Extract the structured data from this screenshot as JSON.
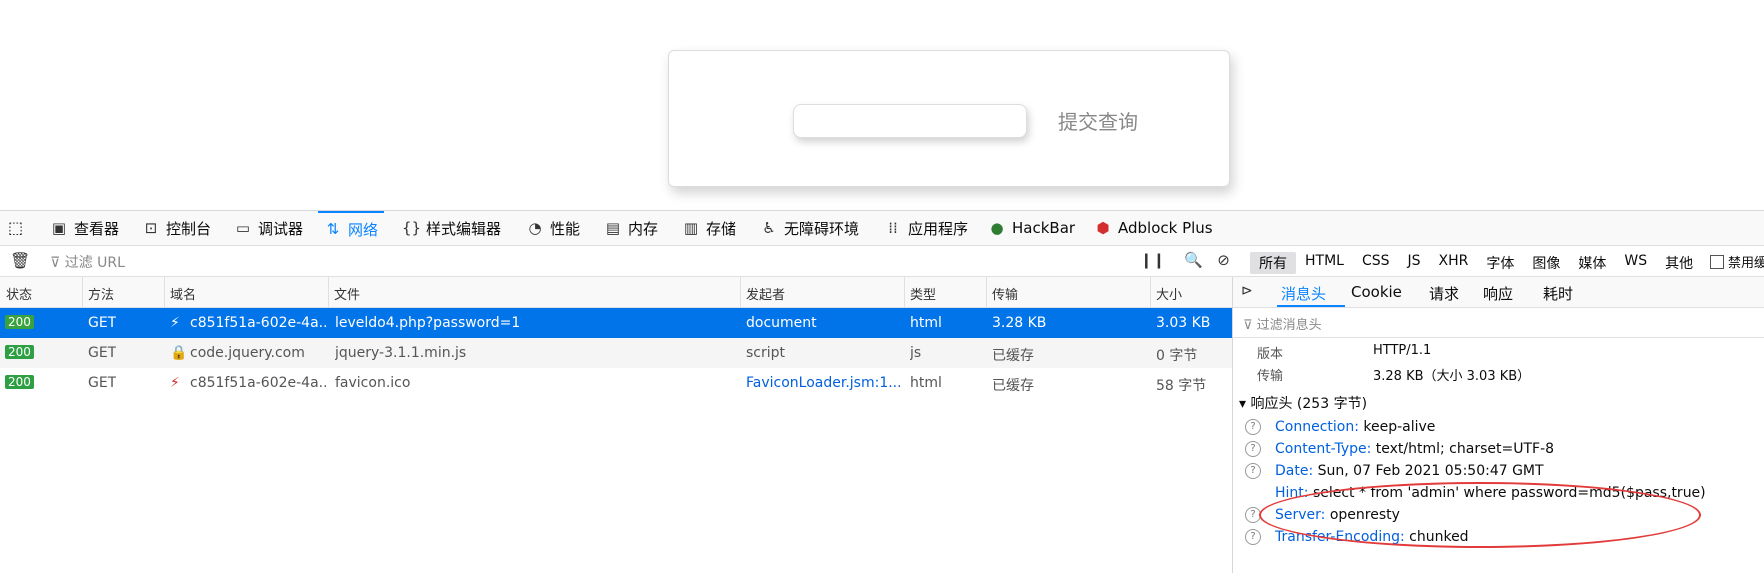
{
  "page": {
    "submit_label": "提交查询"
  },
  "devtools": {
    "tabs": [
      {
        "label": "查看器",
        "icon": "inspector-icon"
      },
      {
        "label": "控制台",
        "icon": "console-icon"
      },
      {
        "label": "调试器",
        "icon": "debugger-icon"
      },
      {
        "label": "网络",
        "icon": "network-icon",
        "active": true
      },
      {
        "label": "样式编辑器",
        "icon": "style-editor-icon"
      },
      {
        "label": "性能",
        "icon": "performance-icon"
      },
      {
        "label": "内存",
        "icon": "memory-icon"
      },
      {
        "label": "存储",
        "icon": "storage-icon"
      },
      {
        "label": "无障碍环境",
        "icon": "accessibility-icon"
      },
      {
        "label": "应用程序",
        "icon": "application-icon"
      },
      {
        "label": "HackBar",
        "icon": "hackbar-icon"
      },
      {
        "label": "Adblock Plus",
        "icon": "adblock-icon"
      }
    ],
    "filter_placeholder": "过滤 URL",
    "type_filters": [
      "所有",
      "HTML",
      "CSS",
      "JS",
      "XHR",
      "字体",
      "图像",
      "媒体",
      "WS",
      "其他"
    ],
    "disable_cache_label": "禁用缓",
    "columns": [
      "状态",
      "方法",
      "域名",
      "文件",
      "发起者",
      "类型",
      "传输",
      "大小"
    ],
    "requests": [
      {
        "status": "200",
        "method": "GET",
        "domain": "c851f51a-602e-4a...",
        "file": "leveldo4.php?password=1",
        "initiator": "document",
        "type": "html",
        "transferred": "3.28 KB",
        "size": "3.03 KB"
      },
      {
        "status": "200",
        "method": "GET",
        "domain": "code.jquery.com",
        "file": "jquery-3.1.1.min.js",
        "initiator": "script",
        "type": "js",
        "transferred": "已缓存",
        "size": "0 字节"
      },
      {
        "status": "200",
        "method": "GET",
        "domain": "c851f51a-602e-4a...",
        "file": "favicon.ico",
        "initiator": "FaviconLoader.jsm:1...",
        "type": "html",
        "transferred": "已缓存",
        "size": "58 字节"
      }
    ],
    "side": {
      "tabs": [
        "消息头",
        "Cookie",
        "请求",
        "响应",
        "耗时"
      ],
      "filter_placeholder": "过滤消息头",
      "version_label": "版本",
      "version_value": "HTTP/1.1",
      "transfer_label": "传输",
      "transfer_value": "3.28 KB（大小 3.03 KB）",
      "response_section": "响应头 (253 字节)",
      "headers": [
        {
          "name": "Connection:",
          "value": "keep-alive"
        },
        {
          "name": "Content-Type:",
          "value": "text/html; charset=UTF-8"
        },
        {
          "name": "Date:",
          "value": "Sun, 07 Feb 2021 05:50:47 GMT"
        },
        {
          "name": "Hint:",
          "value": "select * from 'admin' where password=md5($pass,true)"
        },
        {
          "name": "Server:",
          "value": "openresty"
        },
        {
          "name": "Transfer-Encoding:",
          "value": "chunked"
        }
      ]
    }
  }
}
